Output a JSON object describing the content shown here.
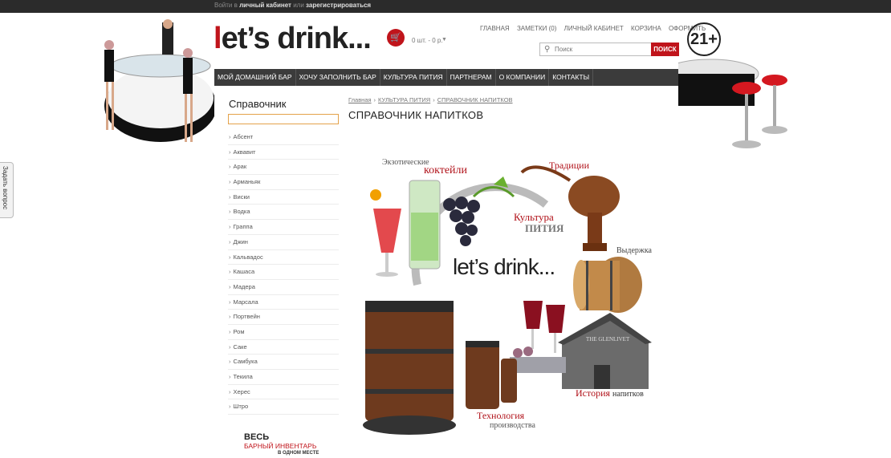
{
  "topbar": {
    "login_prefix": "Войти в",
    "cabinet": "личный кабинет",
    "or": "или",
    "register": "зарегистрироваться"
  },
  "logo": {
    "first": "l",
    "rest": "et’s drink..."
  },
  "cart": {
    "summary": "0 шт. - 0 р."
  },
  "top_links": [
    "ГЛАВНАЯ",
    "ЗАМЕТКИ (0)",
    "ЛИЧНЫЙ КАБИНЕТ",
    "КОРЗИНА",
    "ОФОРМИТЬ"
  ],
  "search": {
    "placeholder": "Поиск",
    "button": "ПОИСК"
  },
  "age_badge": "21+",
  "nav": [
    "МОЙ ДОМАШНИЙ БАР",
    "ХОЧУ ЗАПОЛНИТЬ БАР",
    "КУЛЬТУРА ПИТИЯ",
    "ПАРТНЕРАМ",
    "О КОМПАНИИ",
    "КОНТАКТЫ"
  ],
  "sidebar": {
    "title": "Справочник",
    "items": [
      "Абсент",
      "Аквавит",
      "Арак",
      "Арманьяк",
      "Виски",
      "Водка",
      "Граппа",
      "Джин",
      "Кальвадос",
      "Кашаса",
      "Мадера",
      "Марсала",
      "Портвейн",
      "Ром",
      "Саке",
      "Самбука",
      "Текила",
      "Херес",
      "Штро"
    ]
  },
  "promo": {
    "line1": "ВЕСЬ",
    "line2": "БАРНЫЙ ИНВЕНТАРЬ",
    "line3": "В ОДНОМ МЕСТЕ"
  },
  "breadcrumb": [
    "Главная",
    "КУЛЬТУРА ПИТИЯ",
    "СПРАВОЧНИК НАПИТКОВ"
  ],
  "page_title": "СПРАВОЧНИК НАПИТКОВ",
  "collage": {
    "exotic_small": "Экзотические",
    "exotic_big": "коктейли",
    "traditions": "Традиции",
    "culture_top": "Культура",
    "culture_bottom": "ПИТИЯ",
    "aging": "Выдержка",
    "history_big": "История",
    "history_small": "напитков",
    "tech_big": "Технология",
    "tech_small": "производства",
    "center_logo": "let’s drink...",
    "building_sign": "THE GLENLIVET"
  },
  "ask_tab": "Задать вопрос",
  "colors": {
    "accent": "#c0141b",
    "nav_bg": "#3b3b3b",
    "topbar_bg": "#2b2b2b"
  }
}
